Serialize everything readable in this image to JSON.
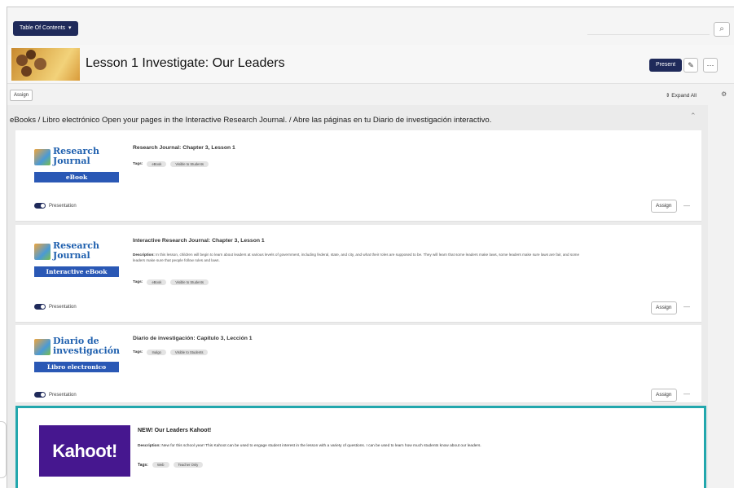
{
  "toolbar": {
    "toc_label": "Table Of Contents",
    "present_label": "Present",
    "assign_label": "Assign",
    "expand_all_label": "Expand All"
  },
  "header": {
    "title": "Lesson 1 Investigate: Our Leaders"
  },
  "section": {
    "title": "eBooks / Libro electrónico Open your pages in the Interactive Research Journal. / Abre las páginas en tu Diario de investigación interactivo."
  },
  "cards": [
    {
      "cover_line1": "Research",
      "cover_line2": "Journal",
      "cover_band": "eBook",
      "title": "Research Journal: Chapter 3, Lesson 1",
      "tags_label": "Tags:",
      "tags": [
        "eBook",
        "Visible to Students"
      ],
      "toggle_label": "Presentation",
      "assign_label": "Assign"
    },
    {
      "cover_line1": "Research",
      "cover_line2": "Journal",
      "cover_band": "Interactive eBook",
      "title": "Interactive Research Journal: Chapter 3, Lesson 1",
      "description_label": "Description:",
      "description": "In this lesson, children will begin to learn about leaders at various levels of government, including federal, state, and city, and what their roles are supposed to be. They will learn that some leaders make laws, some leaders make sure laws are fair, and some leaders make sure that people follow rules and laws.",
      "tags_label": "Tags:",
      "tags": [
        "eBook",
        "Visible to Students"
      ],
      "toggle_label": "Presentation",
      "assign_label": "Assign"
    },
    {
      "cover_line1": "Diario de",
      "cover_line2": "investigación",
      "cover_band": "Libro electronico",
      "title": "Diario de investigación: Capítulo 3, Lección 1",
      "tags_label": "Tags:",
      "tags": [
        "Inalgo",
        "Visible to Students"
      ],
      "toggle_label": "Presentation",
      "assign_label": "Assign"
    }
  ],
  "kahoot": {
    "logo_text": "Kahoot!",
    "title": "NEW! Our Leaders Kahoot!",
    "description_label": "Description:",
    "description": "New for this school year! This Kahoot can be used to engage student interest in the lesson with a variety of questions. I can be used to learn how much students know about our leaders.",
    "tags_label": "Tags:",
    "tags": [
      "Web",
      "Teacher Only"
    ],
    "highlight_color": "#22a7ad"
  }
}
